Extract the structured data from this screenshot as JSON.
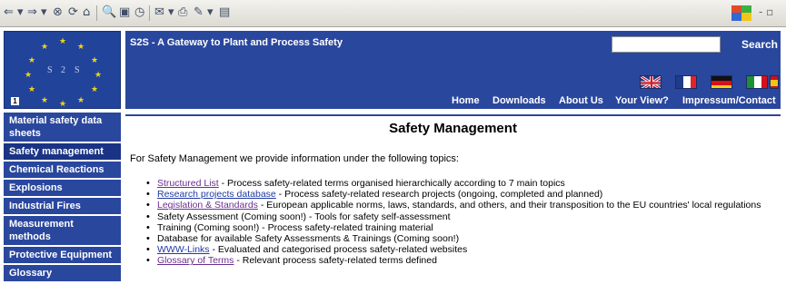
{
  "browser": {
    "toolbar_icons": [
      "back-icon",
      "forward-icon",
      "stop-icon",
      "refresh-icon",
      "home-icon",
      "search-icon",
      "favorites-icon",
      "history-icon",
      "mail-icon",
      "print-icon",
      "edit-icon",
      "discuss-icon"
    ],
    "glyphs": {
      "back": "⇐ ▾",
      "forward": "⇒ ▾",
      "stop": "⊗",
      "refresh": "⟳",
      "home": "⌂",
      "search": "🔍",
      "favorites": "▣",
      "history": "◷",
      "mail": "✉ ▾",
      "print": "⎙",
      "edit": "✎ ▾",
      "discuss": "▤"
    },
    "window_controls": "- ▫"
  },
  "header": {
    "logo_letters": [
      "S",
      "2",
      "S"
    ],
    "logo_corner": "1",
    "title": "S2S - A Gateway to Plant and Process Safety",
    "search": {
      "placeholder": "",
      "value": "",
      "button_label": "Search"
    },
    "flags": [
      {
        "name": "uk-flag",
        "colors": [
          "#1f3b8a",
          "#ffffff",
          "#cf1f2e"
        ]
      },
      {
        "name": "france-flag",
        "colors": [
          "#1f3b8a",
          "#ffffff",
          "#e0242a"
        ]
      },
      {
        "name": "germany-flag",
        "colors": [
          "#111111",
          "#d8101a",
          "#f6cf1a"
        ]
      },
      {
        "name": "italy-flag",
        "colors": [
          "#1d8f35",
          "#ffffff",
          "#d8101a"
        ]
      },
      {
        "name": "spain-flag",
        "colors": [
          "#c8121c",
          "#f3c613",
          "#c8121c"
        ]
      }
    ],
    "nav": [
      "Home",
      "Downloads",
      "About Us",
      "Your View?",
      "Impressum/Contact"
    ]
  },
  "sidebar": {
    "items": [
      {
        "label": "Material safety data sheets"
      },
      {
        "label": "Safety management",
        "active": true
      },
      {
        "label": "Chemical Reactions"
      },
      {
        "label": "Explosions"
      },
      {
        "label": "Industrial Fires"
      },
      {
        "label": "Measurement methods"
      },
      {
        "label": "Protective Equipment"
      },
      {
        "label": "Glossary"
      }
    ]
  },
  "main": {
    "title": "Safety Management",
    "intro": "For Safety Management we provide information under the following topics:",
    "topics": [
      {
        "link": "Structured List",
        "text": " - Process safety-related terms organised hierarchically according to 7 main topics",
        "visited": true
      },
      {
        "link": "Research projects database",
        "text": " - Process safety-related research projects (ongoing, completed and planned)",
        "visited": false
      },
      {
        "link": "Legislation & Standards",
        "text": " - European applicable norms, laws, standards, and others, and their transposition to the EU countries' local regulations",
        "visited": true
      },
      {
        "link": "",
        "text": "Safety Assessment (Coming soon!) - Tools for safety self-assessment"
      },
      {
        "link": "",
        "text": "Training (Coming soon!) - Process safety-related training material"
      },
      {
        "link": "",
        "text": "Database for available Safety Assessments & Trainings (Coming soon!)"
      },
      {
        "link": "WWW-Links",
        "text": " - Evaluated and categorised process safety-related websites",
        "visited": false
      },
      {
        "link": "Glossary of Terms",
        "text": " - Relevant process safety-related terms defined",
        "visited": true
      }
    ]
  },
  "colors": {
    "banner": "#2a479e",
    "sidebar_item": "#2a479e",
    "link_visited": "#6b2e8f",
    "link": "#1f39a6",
    "star": "#f2d21c"
  }
}
